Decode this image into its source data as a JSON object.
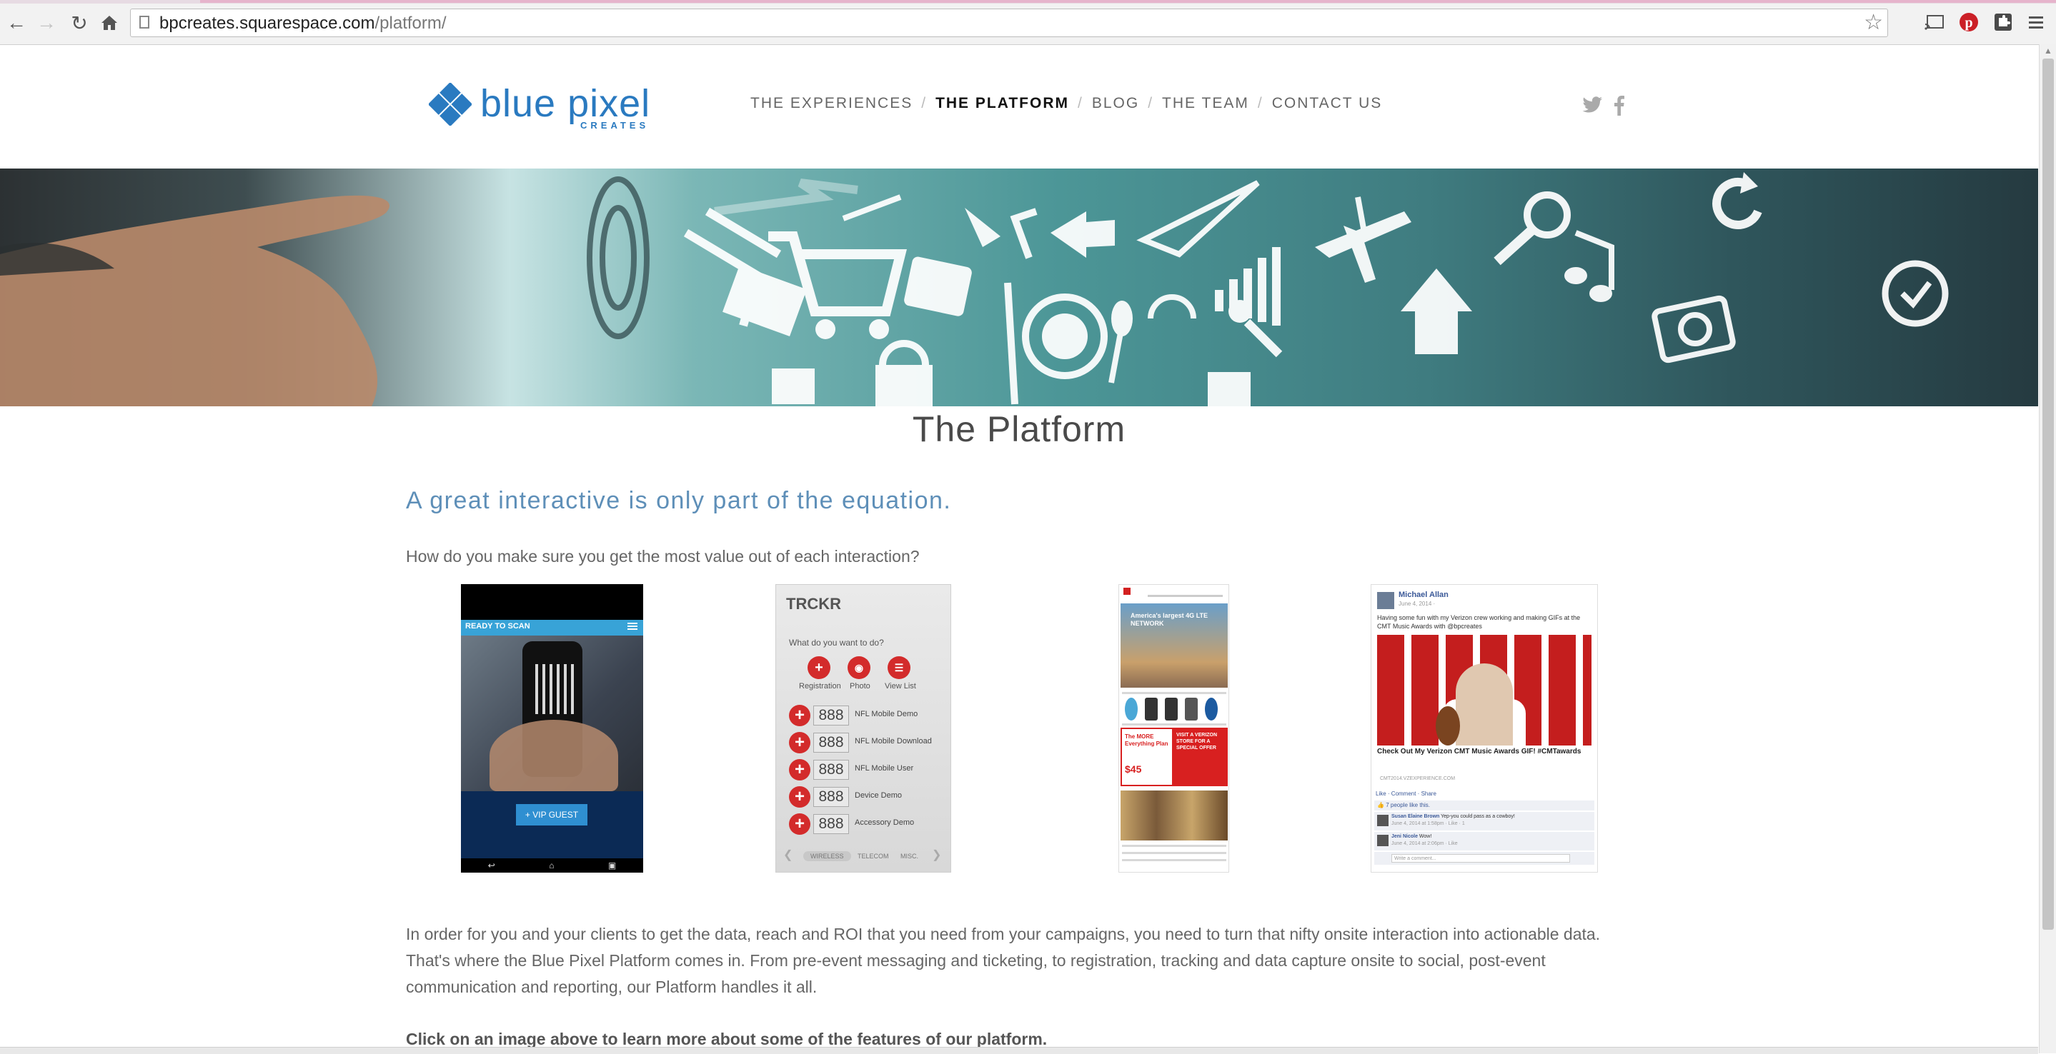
{
  "browser": {
    "url_host": "bpcreates.squarespace.com",
    "url_path": "/platform/",
    "icons": [
      "back-icon",
      "forward-icon",
      "reload-icon",
      "home-icon",
      "page-icon",
      "bookmark-star-icon",
      "cast-icon",
      "pinterest-icon",
      "extension-puzzle-icon",
      "menu-icon"
    ]
  },
  "site": {
    "logo_word": "blue pixel",
    "logo_sub": "CREATES",
    "brand_color": "#2a7ac0",
    "nav": [
      {
        "label": "THE EXPERIENCES",
        "active": false
      },
      {
        "label": "THE PLATFORM",
        "active": true
      },
      {
        "label": "BLOG",
        "active": false
      },
      {
        "label": "THE TEAM",
        "active": false
      },
      {
        "label": "CONTACT US",
        "active": false
      }
    ],
    "social": [
      "twitter-icon",
      "facebook-icon"
    ]
  },
  "page": {
    "title": "The Platform",
    "lead": "A great interactive is only part of the equation.",
    "question": "How do you make sure you get the most value out of each interaction?",
    "body": "In order for you and your clients to get the data, reach and ROI that you need from your campaigns, you need to turn that nifty onsite interaction into actionable data. That's where the Blue Pixel Platform comes in. From pre-event messaging and ticketing, to registration, tracking and data capture onsite to social, post-event communication and reporting, our Platform handles it all.",
    "cta": "Click on an image above to learn more about some of the features of our platform."
  },
  "shots": {
    "scan": {
      "header": "READY TO SCAN",
      "button": "+ VIP GUEST"
    },
    "trckr": {
      "title": "TRCKR",
      "question": "What do you want to do?",
      "actions": [
        "Registration",
        "Photo",
        "View List"
      ],
      "rows": [
        {
          "count": "888",
          "label": "NFL Mobile Demo"
        },
        {
          "count": "888",
          "label": "NFL Mobile Download"
        },
        {
          "count": "888",
          "label": "NFL Mobile User"
        },
        {
          "count": "888",
          "label": "Device Demo"
        },
        {
          "count": "888",
          "label": "Accessory Demo"
        }
      ],
      "tabs": [
        "WIRELESS",
        "TELECOM",
        "MISC."
      ]
    },
    "web": {
      "hero_text": "America's largest 4G LTE NETWORK",
      "promo_left": "The MORE Everything Plan",
      "promo_right": "VISIT A VERIZON STORE FOR A SPECIAL OFFER",
      "price": "$45"
    },
    "fb": {
      "name": "Michael Allan",
      "date": "June 4, 2014 ·",
      "text": "Having some fun with my Verizon crew working and making GIFs at the CMT Music Awards with @bpcreates",
      "caption": "Check Out My Verizon CMT Music Awards GIF! #CMTawards",
      "source": "CMT2014.VZEXPERIENCE.COM",
      "actions": "Like · Comment · Share",
      "likes": "7 people like this.",
      "comments": [
        {
          "name": "Susan Elaine Brown",
          "text": "Yep-you could pass as a cowboy!",
          "meta": "June 4, 2014 at 1:58pm · Like · 1"
        },
        {
          "name": "Jeni Nicole",
          "text": "Wow!",
          "meta": "June 4, 2014 at 2:06pm · Like"
        }
      ],
      "write_placeholder": "Write a comment..."
    }
  }
}
